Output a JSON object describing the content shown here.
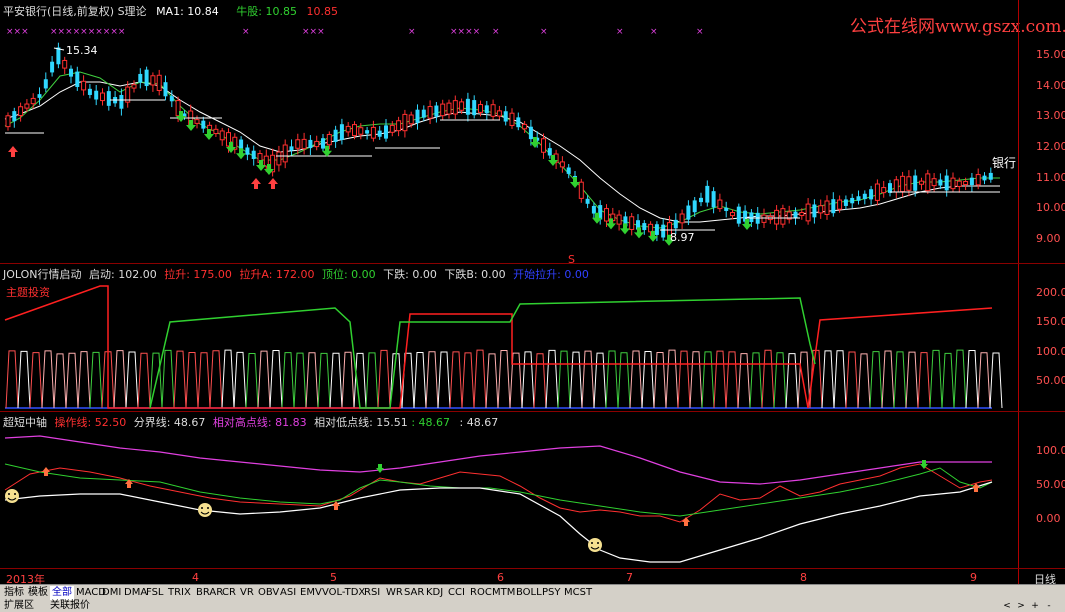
{
  "main": {
    "title": "平安银行(日线,前复权) S理论",
    "ma_label": "MA1: 10.84",
    "niu_label": "牛股:",
    "niu_v1": "10.85",
    "niu_v2": "10.85",
    "watermark": "公式在线网www.gszx.com.cn",
    "high_label": "15.34",
    "low_label": "8.97",
    "bank_label": "银行",
    "s_label": "S",
    "yticks": [
      "15.00",
      "14.00",
      "13.00",
      "12.00",
      "11.00",
      "10.00",
      "9.00"
    ]
  },
  "ind1": {
    "name": "JOLON行情启动",
    "qidong": "启动: 102.00",
    "lasheng": "拉升: 175.00",
    "lashengA": "拉升A: 172.00",
    "dingwei": "顶位: 0.00",
    "xiadie": "下跌: 0.00",
    "xiadieB": "下跌B: 0.00",
    "kaishi": "开始拉升: 0.00",
    "zhuli": "主题投资",
    "yticks": [
      "200.0",
      "150.0",
      "100.0",
      "50.00"
    ]
  },
  "ind2": {
    "name": "超短中轴",
    "caozuo": "操作线: 52.50",
    "fenjie": "分界线: 48.67",
    "gaodian": "相对高点线: 81.83",
    "didian_label": "相对低点线: 15.51",
    "didian_v2": ": 48.67",
    "extra": ": 48.67",
    "yticks": [
      "100.0",
      "50.00",
      "0.00"
    ]
  },
  "xaxis": {
    "labels": [
      "2013年",
      "4",
      "5",
      "6",
      "7",
      "8",
      "9"
    ],
    "period": "日线"
  },
  "tabs": [
    "指标",
    "模板",
    "全部",
    "MACD",
    "DMI",
    "DMA",
    "FSL",
    "TRIX",
    "BRAR",
    "CR",
    "VR",
    "OBV",
    "ASI",
    "EMV",
    "VOL-TDX",
    "RSI",
    "WR",
    "SAR",
    "KDJ",
    "CCI",
    "ROC",
    "MTM",
    "BOLL",
    "PSY",
    "MCST"
  ],
  "bottom": {
    "left": "扩展区",
    "right": "关联报价",
    "nav": [
      "<",
      ">",
      "+",
      "-"
    ]
  },
  "colors": {
    "up": "#ff3030",
    "down": "#40e0ff",
    "ma": "#ffffff",
    "green": "#40d040",
    "magenta": "#e040e0",
    "grid": "#8a0000"
  }
}
